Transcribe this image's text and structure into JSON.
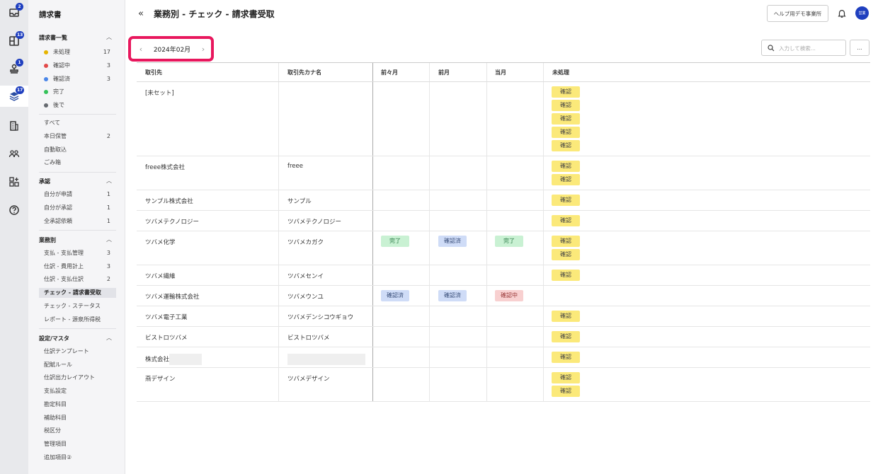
{
  "rail": {
    "items": [
      {
        "icon": "inbox-icon",
        "badge": "2"
      },
      {
        "icon": "book-icon",
        "badge": "13"
      },
      {
        "icon": "stamp-icon",
        "badge": "1"
      },
      {
        "icon": "layers-icon",
        "badge": "17"
      },
      {
        "icon": "building-icon",
        "badge": ""
      },
      {
        "icon": "team-icon",
        "badge": ""
      },
      {
        "icon": "apps-add-icon",
        "badge": ""
      },
      {
        "icon": "help-icon",
        "badge": ""
      }
    ]
  },
  "sidebar": {
    "title": "請求書",
    "section_list": {
      "label": "請求書一覧",
      "items": [
        {
          "label": "未処理",
          "count": "17",
          "color": "#e6b400"
        },
        {
          "label": "確認中",
          "count": "3",
          "color": "#e24a4a"
        },
        {
          "label": "確認済",
          "count": "3",
          "color": "#4a86e8"
        },
        {
          "label": "完了",
          "count": "",
          "color": "#35c25a"
        },
        {
          "label": "後で",
          "count": "",
          "color": "#666a70"
        }
      ]
    },
    "misc": [
      {
        "label": "すべて",
        "count": ""
      },
      {
        "label": "本日保管",
        "count": "2"
      },
      {
        "label": "自動取込",
        "count": ""
      },
      {
        "label": "ごみ箱",
        "count": ""
      }
    ],
    "section_approval": {
      "label": "承認",
      "items": [
        {
          "label": "自分が申請",
          "count": "1"
        },
        {
          "label": "自分が承認",
          "count": "1"
        },
        {
          "label": "全承認依頼",
          "count": "1"
        }
      ]
    },
    "section_work": {
      "label": "業務別",
      "items": [
        {
          "label": "支払 - 支払管理",
          "count": "3"
        },
        {
          "label": "仕訳 - 費用計上",
          "count": "3"
        },
        {
          "label": "仕訳 - 支払仕訳",
          "count": "2"
        },
        {
          "label": "チェック - 請求書受取",
          "count": ""
        },
        {
          "label": "チェック - ステータス",
          "count": ""
        },
        {
          "label": "レポート - 源泉所得税",
          "count": ""
        }
      ]
    },
    "section_settings": {
      "label": "設定/マスタ",
      "items": [
        {
          "label": "仕訳テンプレート"
        },
        {
          "label": "配賦ルール"
        },
        {
          "label": "仕訳出力レイアウト"
        },
        {
          "label": "支払設定"
        },
        {
          "label": "勘定科目"
        },
        {
          "label": "補助科目"
        },
        {
          "label": "税区分"
        },
        {
          "label": "管理項目"
        },
        {
          "label": "追加項目②"
        }
      ]
    }
  },
  "header": {
    "title": "業務別 - チェック - 請求書受取",
    "help_button": "ヘルプ用デモ事業所",
    "avatar_text": "営業"
  },
  "toolbar": {
    "month": "2024年02月",
    "search_placeholder": "入力して検索...",
    "more_label": "..."
  },
  "table": {
    "columns": [
      "取引先",
      "取引先カナ名",
      "前々月",
      "前月",
      "当月",
      "未処理"
    ],
    "rows": [
      {
        "name": "[未セット]",
        "kana": "",
        "m2": "",
        "m1": "",
        "m0": "",
        "pending": [
          "確認",
          "確認",
          "確認",
          "確認",
          "確認"
        ]
      },
      {
        "name": "freee株式会社",
        "kana": "freee",
        "m2": "",
        "m1": "",
        "m0": "",
        "pending": [
          "確認",
          "確認"
        ]
      },
      {
        "name": "サンプル株式会社",
        "kana": "サンプル",
        "m2": "",
        "m1": "",
        "m0": "",
        "pending": [
          "確認"
        ]
      },
      {
        "name": "ツバメテクノロジー",
        "kana": "ツバメテクノロジー",
        "m2": "",
        "m1": "",
        "m0": "",
        "pending": [
          "確認"
        ]
      },
      {
        "name": "ツバメ化学",
        "kana": "ツバメカガク",
        "m2": "完了",
        "m1": "確認済",
        "m0": "完了",
        "pending": [
          "確認",
          "確認"
        ]
      },
      {
        "name": "ツバメ繊維",
        "kana": "ツバメセンイ",
        "m2": "",
        "m1": "",
        "m0": "",
        "pending": [
          "確認"
        ]
      },
      {
        "name": "ツバメ運輸株式会社",
        "kana": "ツバメウンユ",
        "m2": "確認済",
        "m1": "確認済",
        "m0": "確認中",
        "pending": []
      },
      {
        "name": "ツバメ電子工業",
        "kana": "ツバメデンシコウギョウ",
        "m2": "",
        "m1": "",
        "m0": "",
        "pending": [
          "確認"
        ]
      },
      {
        "name": "ビストロツバメ",
        "kana": "ビストロツバメ",
        "m2": "",
        "m1": "",
        "m0": "",
        "pending": [
          "確認"
        ]
      },
      {
        "name": "株式会社",
        "kana": "",
        "m2": "",
        "m1": "",
        "m0": "",
        "pending": [
          "確認"
        ],
        "redacted": true
      },
      {
        "name": "燕デザイン",
        "kana": "ツバメデザイン",
        "m2": "",
        "m1": "",
        "m0": "",
        "pending": [
          "確認",
          "確認"
        ]
      }
    ]
  },
  "colors": {
    "accent": "#1f3fbf",
    "highlight": "#e8175d",
    "pending_pill": "#fbe97a",
    "done_pill": "#c9f1d3",
    "confirmed_pill": "#cfdcf7",
    "checking_pill": "#f8d0d0"
  }
}
